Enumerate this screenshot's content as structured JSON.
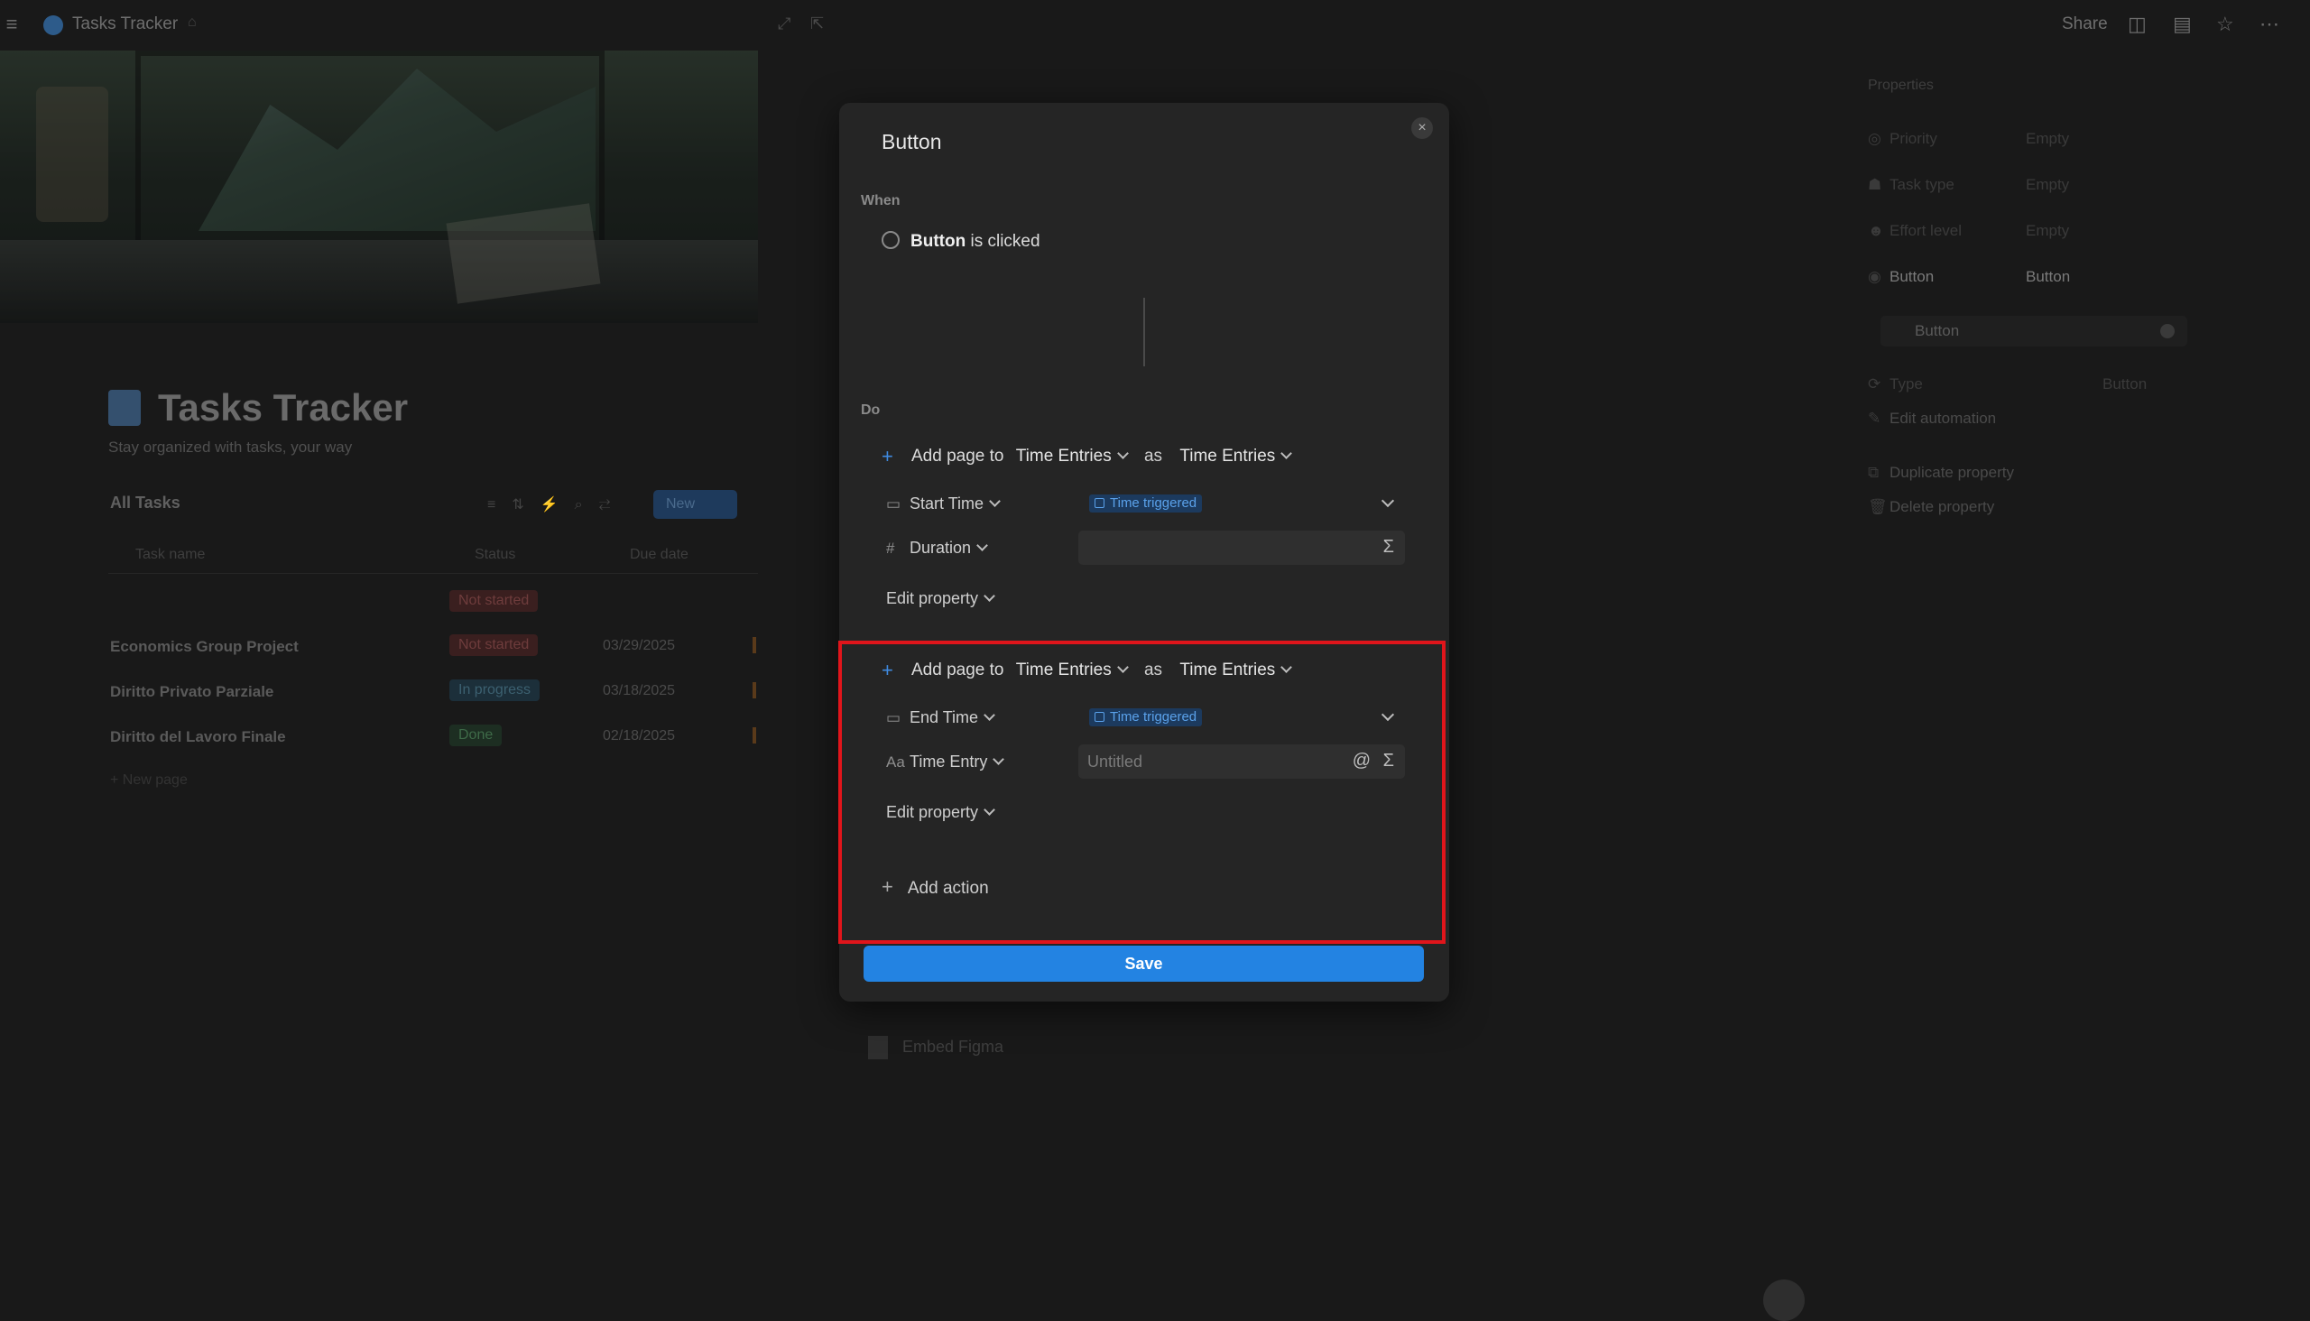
{
  "topbar": {
    "page_title": "Tasks Tracker",
    "share_label": "Share"
  },
  "page": {
    "title": "Tasks Tracker",
    "subtitle": "Stay organized with tasks, your way",
    "view_tab": "All Tasks",
    "new_button": "New",
    "columns": [
      "Task name",
      "Status",
      "Due date"
    ],
    "rows": [
      {
        "name": "",
        "status": "Not started",
        "status_kind": "ns",
        "date": ""
      },
      {
        "name": "Economics Group Project",
        "status": "Not started",
        "status_kind": "ns",
        "date": "03/29/2025"
      },
      {
        "name": "Diritto Privato Parziale",
        "status": "In progress",
        "status_kind": "ip",
        "date": "03/18/2025"
      },
      {
        "name": "Diritto del Lavoro Finale",
        "status": "Done",
        "status_kind": "dn",
        "date": "02/18/2025"
      }
    ],
    "new_row_label": "+ New page",
    "behind_modal_row": "Embed Figma"
  },
  "properties_panel": {
    "title": "Properties",
    "rows": [
      {
        "icon": "◎",
        "label": "Priority",
        "value": "Empty"
      },
      {
        "icon": "☗",
        "label": "Task type",
        "value": "Empty"
      },
      {
        "icon": "☻",
        "label": "Effort level",
        "value": "Empty"
      },
      {
        "icon": "◉",
        "label": "Button",
        "value": "Button"
      }
    ],
    "input_value": "Button",
    "type_label": "Type",
    "type_value": "Button",
    "edit_automation": "Edit automation",
    "duplicate_property": "Duplicate property",
    "delete_property": "Delete property"
  },
  "modal": {
    "title": "Button",
    "close_icon": "×",
    "when_label": "When",
    "trigger_bold": "Button",
    "trigger_rest": " is clicked",
    "do_label": "Do",
    "actions": [
      {
        "prefix": "Add page to",
        "database": "Time Entries",
        "as_word": "as",
        "template": "Time Entries",
        "props": [
          {
            "icon": "calendar-icon",
            "glyph": "▭",
            "label": "Start Time",
            "value_tag": "Time triggered"
          },
          {
            "icon": "hash-icon",
            "glyph": "#",
            "label": "Duration",
            "placeholder": ""
          }
        ],
        "edit_property": "Edit property"
      },
      {
        "prefix": "Add page to",
        "database": "Time Entries",
        "as_word": "as",
        "template": "Time Entries",
        "props": [
          {
            "icon": "calendar-icon",
            "glyph": "▭",
            "label": "End Time",
            "value_tag": "Time triggered"
          },
          {
            "icon": "text-icon",
            "glyph": "Aa",
            "label": "Time Entry",
            "placeholder": "Untitled"
          }
        ],
        "edit_property": "Edit property"
      }
    ],
    "add_action": "Add action",
    "save": "Save"
  },
  "colors": {
    "accent": "#2383e2",
    "highlight": "#e0151b",
    "tag_bg": "#1c3a5e",
    "tag_text": "#5aa1ea"
  }
}
